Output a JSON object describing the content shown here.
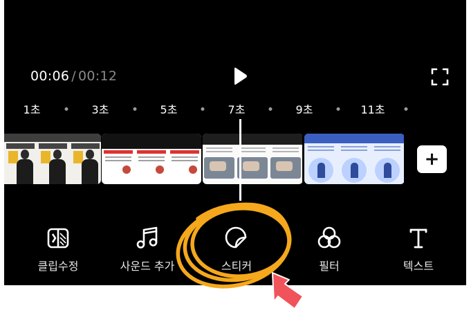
{
  "player": {
    "current_time": "00:06",
    "separator": "/",
    "total_time": "00:12",
    "play_icon": "play-icon",
    "fullscreen_icon": "fullscreen-icon"
  },
  "ruler": {
    "labels": [
      "1초",
      "3초",
      "5초",
      "7초",
      "9초",
      "11초"
    ]
  },
  "timeline": {
    "playhead_seconds": 6,
    "clips": [
      "person",
      "warning",
      "desk",
      "blue"
    ],
    "add_label": "+"
  },
  "toolbar": {
    "items": [
      {
        "label": "클립수정",
        "icon": "clip-edit-icon"
      },
      {
        "label": "사운드 추가",
        "icon": "music-icon"
      },
      {
        "label": "스티커",
        "icon": "sticker-icon"
      },
      {
        "label": "필터",
        "icon": "filter-icon"
      },
      {
        "label": "텍스트",
        "icon": "text-icon"
      }
    ]
  },
  "annotation": {
    "highlight_color": "#f5a81c",
    "cursor_color": "#f0535a"
  }
}
